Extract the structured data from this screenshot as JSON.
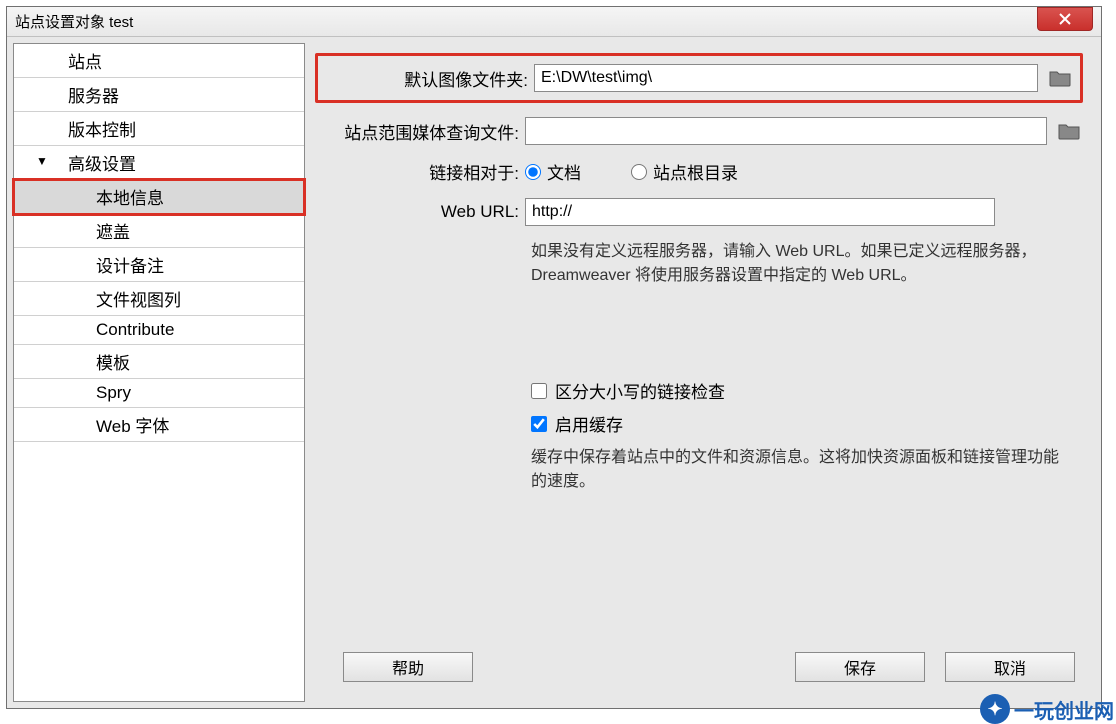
{
  "window": {
    "title": "站点设置对象 test"
  },
  "sidebar": {
    "items": [
      {
        "label": "站点",
        "level": "top"
      },
      {
        "label": "服务器",
        "level": "top"
      },
      {
        "label": "版本控制",
        "level": "top"
      },
      {
        "label": "高级设置",
        "level": "expandable"
      },
      {
        "label": "本地信息",
        "level": "child",
        "selected": true
      },
      {
        "label": "遮盖",
        "level": "child"
      },
      {
        "label": "设计备注",
        "level": "child"
      },
      {
        "label": "文件视图列",
        "level": "child"
      },
      {
        "label": "Contribute",
        "level": "child"
      },
      {
        "label": "模板",
        "level": "child"
      },
      {
        "label": "Spry",
        "level": "child"
      },
      {
        "label": "Web 字体",
        "level": "child"
      }
    ]
  },
  "form": {
    "default_images_label": "默认图像文件夹:",
    "default_images_value": "E:\\DW\\test\\img\\",
    "media_query_label": "站点范围媒体查询文件:",
    "media_query_value": "",
    "links_relative_label": "链接相对于:",
    "links_relative_options": {
      "document": "文档",
      "site_root": "站点根目录"
    },
    "links_relative_selected": "document",
    "web_url_label": "Web URL:",
    "web_url_value": "http://",
    "web_url_help": "如果没有定义远程服务器，请输入 Web URL。如果已定义远程服务器，Dreamweaver 将使用服务器设置中指定的 Web URL。",
    "case_sensitive_label": "区分大小写的链接检查",
    "case_sensitive_checked": false,
    "enable_cache_label": "启用缓存",
    "enable_cache_checked": true,
    "cache_help": "缓存中保存着站点中的文件和资源信息。这将加快资源面板和链接管理功能的速度。"
  },
  "buttons": {
    "help": "帮助",
    "save": "保存",
    "cancel": "取消"
  },
  "watermark": {
    "text": "一玩创业网"
  }
}
